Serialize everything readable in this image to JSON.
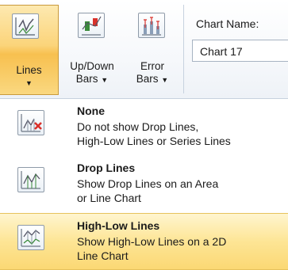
{
  "ribbon": {
    "lines_button": {
      "label": "Lines",
      "icon": "line-chart-icon"
    },
    "updown_bars_button": {
      "label_line1": "Up/Down",
      "label_line2": "Bars",
      "icon": "up-down-bars-icon"
    },
    "error_bars_button": {
      "label_line1": "Error",
      "label_line2": "Bars",
      "icon": "error-bars-icon"
    },
    "dropdown_arrow": "▼",
    "chart_name": {
      "label": "Chart Name:",
      "value": "Chart 17"
    }
  },
  "menu": {
    "items": [
      {
        "title": "None",
        "desc_line1": "Do not show Drop Lines,",
        "desc_line2": "High-Low Lines or Series Lines",
        "icon": "no-lines-icon"
      },
      {
        "title": "Drop Lines",
        "desc_line1": "Show Drop Lines on an Area",
        "desc_line2": "or Line Chart",
        "icon": "drop-lines-icon"
      },
      {
        "title": "High-Low Lines",
        "desc_line1": "Show High-Low Lines on a 2D",
        "desc_line2": "Line Chart",
        "icon": "high-low-lines-icon",
        "highlighted": true
      }
    ]
  },
  "colors": {
    "highlight": "#fbd874",
    "accent_red": "#d9312b",
    "icon_green": "#3a8a3a"
  }
}
